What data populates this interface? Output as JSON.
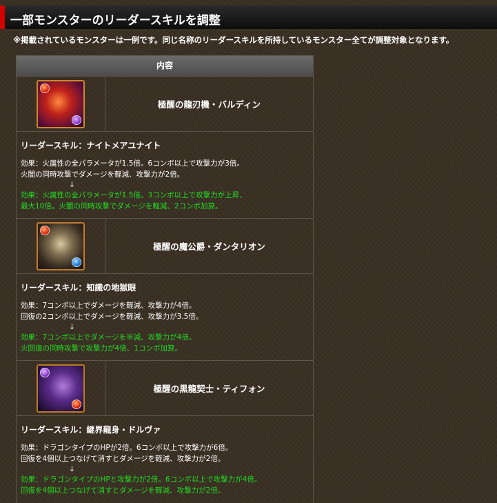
{
  "header": {
    "title": "一部モンスターのリーダースキルを調整"
  },
  "notice": "※掲載されているモンスターは一例です。同じ名称のリーダースキルを所持しているモンスター全てが調整対象となります。",
  "table": {
    "column_header": "内容",
    "arrow": "↓",
    "rows": [
      {
        "monster_name": "極醒の龍刃機・バルディン",
        "icon": "fire-dragon-machine-icon",
        "skill_name": "リーダースキル：ナイトメアユナイト",
        "before": [
          "効果：火属性の全パラメータが1.5倍。6コンボ以上で攻撃力が3倍。",
          "火闇の同時攻撃でダメージを軽減、攻撃力が2倍。"
        ],
        "after": [
          "効果：火属性の全パラメータが1.5倍。3コンボ以上で攻撃力が上昇、",
          "最大10倍。火闇の同時攻撃でダメージを軽減、2コンボ加算。"
        ]
      },
      {
        "monster_name": "極醒の魔公爵・ダンタリオン",
        "icon": "demon-duke-icon",
        "skill_name": "リーダースキル：知識の地獄眼",
        "before": [
          "効果：7コンボ以上でダメージを軽減、攻撃力が4倍。",
          "回復の2コンボ以上でダメージを軽減、攻撃力が3.5倍。"
        ],
        "after": [
          "効果：7コンボ以上でダメージを半減、攻撃力が4倍。",
          "火回復の同時攻撃で攻撃力が4倍、1コンボ加算。"
        ]
      },
      {
        "monster_name": "極醒の黒龍契士・ティフォン",
        "icon": "black-dragon-contractor-icon",
        "skill_name": "リーダースキル：継界龍身・ドルヴァ",
        "before": [
          "効果：ドラゴンタイプのHPが2倍。6コンボ以上で攻撃力が6倍。",
          "回復を4個以上つなげて消すとダメージを軽減、攻撃力が2倍。"
        ],
        "after": [
          "効果：ドラゴンタイプのHPと攻撃力が2倍。6コンボ以上で攻撃力が4倍。",
          "回復を4個以上つなげて消すとダメージを軽減、攻撃力が2倍。"
        ]
      }
    ]
  },
  "colors": {
    "accent_red": "#d40000",
    "new_effect_green": "#22dd22"
  }
}
